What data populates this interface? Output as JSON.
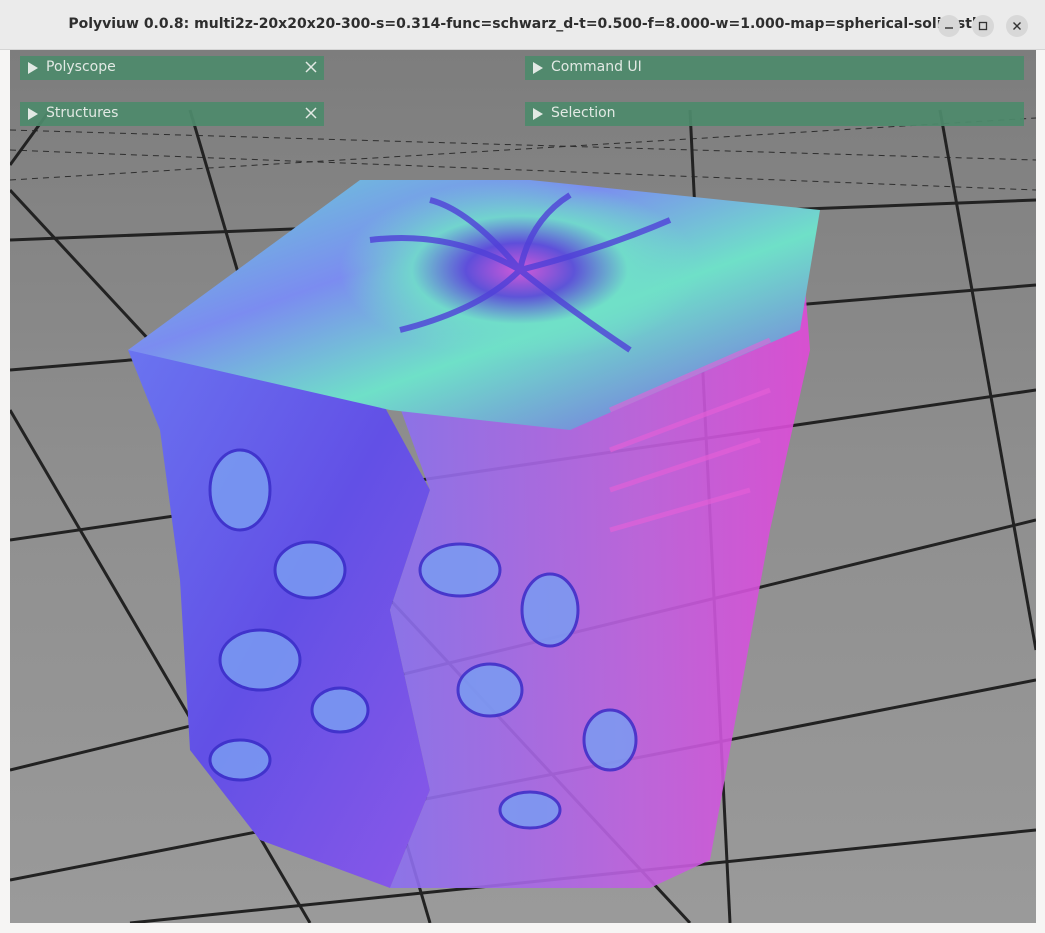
{
  "window": {
    "title": "Polyviuw 0.0.8: multi2z-20x20x20-300-s=0.314-func=schwarz_d-t=0.500-f=8.000-w=1.000-map=spherical-solid.stl",
    "controls": [
      "minimize-icon",
      "maximize-icon",
      "close-icon"
    ]
  },
  "panels": {
    "polyscope": {
      "label": "Polyscope",
      "closable": true
    },
    "structures": {
      "label": "Structures",
      "closable": true
    },
    "command_ui": {
      "label": "Command UI",
      "closable": false
    },
    "selection": {
      "label": "Selection",
      "closable": false
    }
  },
  "colors": {
    "panel_bg": "#4e8a6c",
    "panel_text": "#eaf2ec",
    "floor_tile": "#8a8a8a",
    "floor_line": "#2b2b2b",
    "mesh_blue": "#6a5ae8",
    "mesh_cyan": "#6fe0c8",
    "mesh_magenta": "#e04ad8"
  }
}
